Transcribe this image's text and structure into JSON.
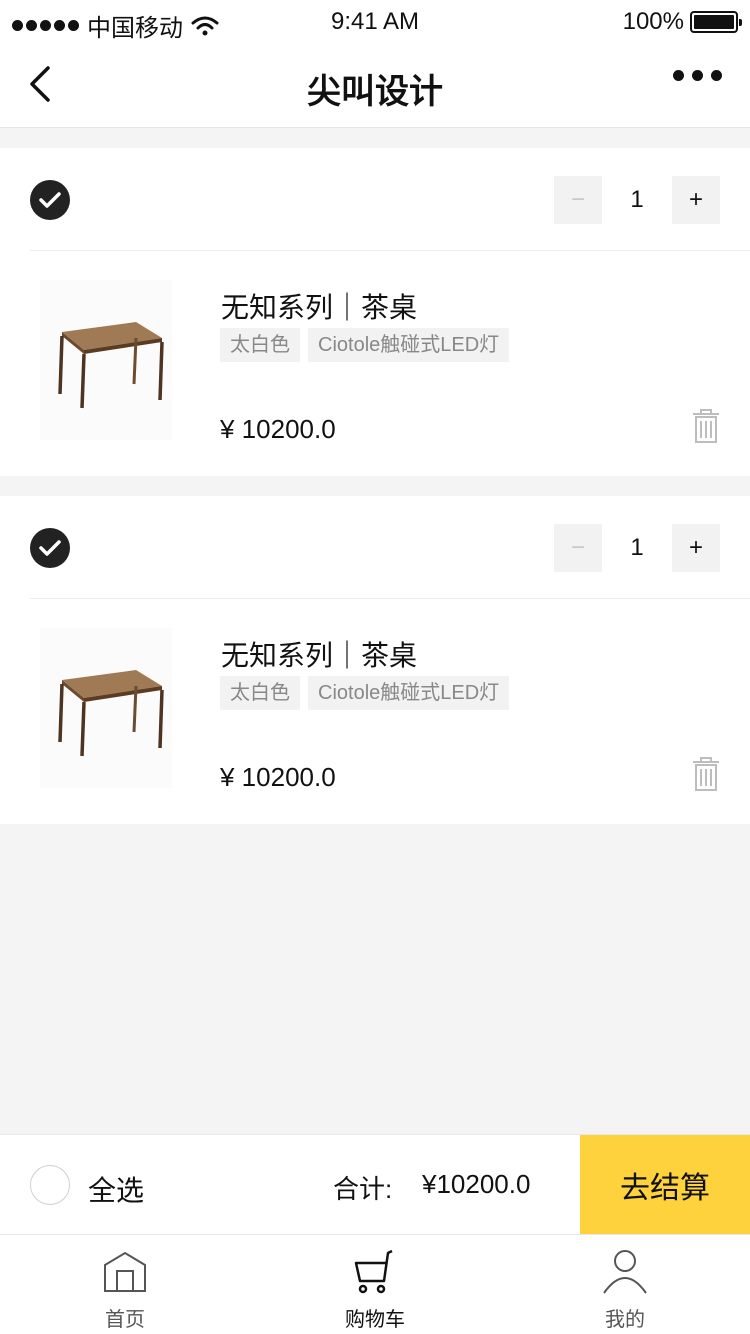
{
  "status_bar": {
    "carrier": "中国移动",
    "time": "9:41 AM",
    "battery": "100%"
  },
  "nav": {
    "title": "尖叫设计"
  },
  "cart_items": [
    {
      "quantity": "1",
      "title": "无知系列｜茶桌",
      "tags": [
        "太白色",
        "Ciotole触碰式LED灯"
      ],
      "price": "¥ 10200.0",
      "checked": true,
      "image_icon": "wooden-table"
    },
    {
      "quantity": "1",
      "title": "无知系列｜茶桌",
      "tags": [
        "太白色",
        "Ciotole触碰式LED灯"
      ],
      "price": "¥ 10200.0",
      "checked": true,
      "image_icon": "wooden-table"
    }
  ],
  "stepper": {
    "minus": "−",
    "plus": "+"
  },
  "checkout": {
    "select_all_label": "全选",
    "total_label": "合计:",
    "total_amount": "¥10200.0",
    "button_label": "去结算"
  },
  "tabs": [
    {
      "label": "首页",
      "icon": "home-icon",
      "active": false
    },
    {
      "label": "购物车",
      "icon": "cart-icon",
      "active": true
    },
    {
      "label": "我的",
      "icon": "user-icon",
      "active": false
    }
  ],
  "colors": {
    "accent": "#fdd23c",
    "background": "#f4f4f4",
    "check": "#222222"
  }
}
